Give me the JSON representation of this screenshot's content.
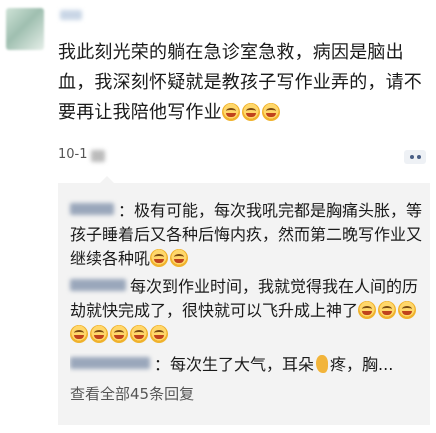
{
  "post": {
    "text": "我此刻光荣的躺在急诊室急救，病因是脑出血，我深刻怀疑就是教孩子写作业弄的，请不要再让我陪他写作业",
    "emojis": [
      "laugh-cry-emoji",
      "laugh-cry-emoji",
      "laugh-cry-emoji"
    ],
    "time": "10-1"
  },
  "comments": [
    {
      "text": "：极有可能，每次我吼完都是胸痛头胀，等孩子睡着后又各种后悔内疚，然而第二晚写作业又继续各种吼",
      "emojis": [
        "laugh-cry-emoji",
        "laugh-cry-emoji"
      ]
    },
    {
      "text": "每次到作业时间，我就觉得我在人间的历劫就快完成了，很快就可以飞升成上神了",
      "emojis": [
        "laugh-cry-emoji",
        "laugh-cry-emoji",
        "laugh-cry-emoji",
        "laugh-cry-emoji",
        "laugh-cry-emoji",
        "laugh-cry-emoji",
        "laugh-cry-emoji",
        "laugh-cry-emoji"
      ]
    },
    {
      "text_before": "：每次生了大气，耳朵",
      "text_after": "疼，胸...",
      "emoji": "ear-emoji"
    }
  ],
  "view_all": "查看全部45条回复",
  "colors": {
    "comment_bg": "#f3f3f3",
    "link": "#4a5f85"
  }
}
